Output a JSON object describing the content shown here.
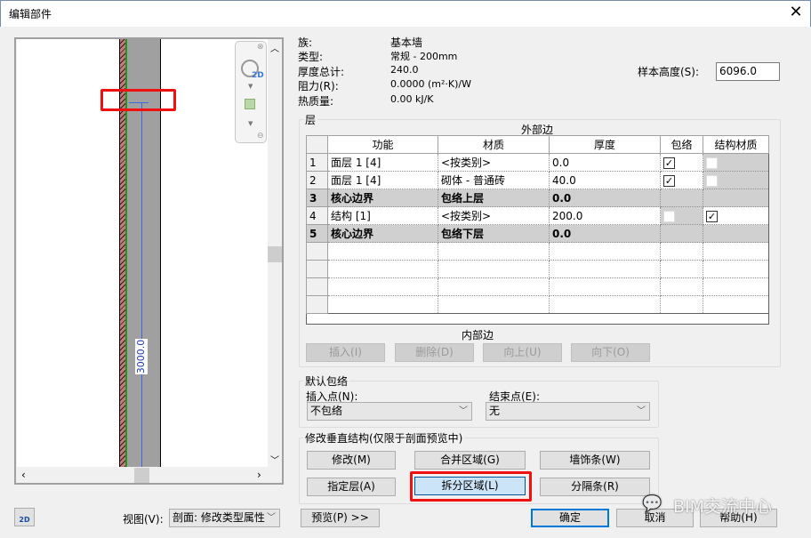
{
  "window": {
    "title": "编辑部件",
    "close_icon": "close-icon"
  },
  "preview": {
    "dimension_label": "3000.0",
    "nav_2d_label": "2D"
  },
  "info": {
    "family_label": "族:",
    "family_value": "基本墙",
    "type_label": "类型:",
    "type_value": "常规 - 200mm",
    "thickness_label": "厚度总计:",
    "thickness_value": "240.0",
    "resistance_label": "阻力(R):",
    "resistance_value": "0.0000 (m²·K)/W",
    "mass_label": "热质量:",
    "mass_value": "0.00 kJ/K",
    "sample_height_label": "样本高度(S):",
    "sample_height_value": "6096.0"
  },
  "layers": {
    "group_title": "层",
    "exterior_label": "外部边",
    "interior_label": "内部边",
    "columns": [
      "功能",
      "材质",
      "厚度",
      "包络",
      "结构材质"
    ],
    "rows": [
      {
        "num": "1",
        "function": "面层 1 [4]",
        "material": "<按类别>",
        "thickness": "0.0",
        "wrap": true,
        "structural": false,
        "bold": false
      },
      {
        "num": "2",
        "function": "面层 1 [4]",
        "material": "砌体 - 普通砖",
        "thickness": "40.0",
        "wrap": true,
        "structural": false,
        "bold": false
      },
      {
        "num": "3",
        "function": "核心边界",
        "material": "包络上层",
        "thickness": "0.0",
        "bold": true
      },
      {
        "num": "4",
        "function": "结构 [1]",
        "material": "<按类别>",
        "thickness": "200.0",
        "wrap": false,
        "structural": true,
        "bold": false
      },
      {
        "num": "5",
        "function": "核心边界",
        "material": "包络下层",
        "thickness": "0.0",
        "bold": true
      }
    ],
    "buttons": {
      "insert": "插入(I)",
      "delete": "删除(D)",
      "up": "向上(U)",
      "down": "向下(O)"
    }
  },
  "wrapping": {
    "group_title": "默认包络",
    "insert_label": "插入点(N):",
    "insert_value": "不包络",
    "end_label": "结束点(E):",
    "end_value": "无"
  },
  "vertical": {
    "group_title": "修改垂直结构(仅限于剖面预览中)",
    "modify": "修改(M)",
    "merge": "合并区域(G)",
    "sweeps": "墙饰条(W)",
    "assign": "指定层(A)",
    "split": "拆分区域(L)",
    "reveals": "分隔条(R)"
  },
  "footer": {
    "view_label": "视图(V):",
    "view_value": "剖面: 修改类型属性",
    "preview": "预览(P) >>",
    "ok": "确定",
    "cancel": "取消",
    "help": "帮助(H)",
    "watermark": "BIM交流中心"
  },
  "colors": {
    "highlight": "#f01010",
    "primary_border": "#0078d7"
  }
}
